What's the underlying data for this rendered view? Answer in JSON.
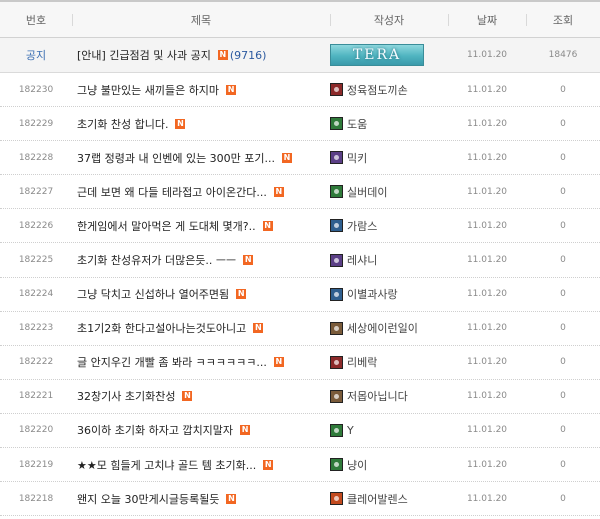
{
  "headers": {
    "no": "번호",
    "title": "제목",
    "author": "작성자",
    "date": "날짜",
    "views": "조회"
  },
  "new_badge": "N",
  "notice": {
    "no": "공지",
    "title": "[안내] 긴급점검 및 사과 공지",
    "comments": "(9716)",
    "author_banner": "TERA",
    "date": "11.01.20",
    "views": "18476"
  },
  "emblem_colors": {
    "red": "#8c2a2a",
    "green": "#2f7a3a",
    "purple": "#5b3f86",
    "blue": "#2f5f8f",
    "brown": "#7a5b3a",
    "orange": "#c24a1e"
  },
  "posts": [
    {
      "no": "182230",
      "title": "그냥 불만있는 새끼들은 하지마",
      "author": "정육점도끼손",
      "emblem": "red",
      "date": "11.01.20",
      "views": "0"
    },
    {
      "no": "182229",
      "title": "초기화 찬성 합니다.",
      "author": "도움",
      "emblem": "green",
      "date": "11.01.20",
      "views": "0"
    },
    {
      "no": "182228",
      "title": "37랩 정령과 내 인벤에 있는 300만 포기...",
      "author": "믹키",
      "emblem": "purple",
      "date": "11.01.20",
      "views": "0"
    },
    {
      "no": "182227",
      "title": "근데 보면 왜 다들 테라접고 아이온간다...",
      "author": "실버데이",
      "emblem": "green",
      "date": "11.01.20",
      "views": "0"
    },
    {
      "no": "182226",
      "title": "한게임에서 말아먹은 게 도대체 몇개?..",
      "author": "가람스",
      "emblem": "blue",
      "date": "11.01.20",
      "views": "0"
    },
    {
      "no": "182225",
      "title": "초기화 찬성유저가 더많은듯.. ㅡㅡ",
      "author": "레샤니",
      "emblem": "purple",
      "date": "11.01.20",
      "views": "0"
    },
    {
      "no": "182224",
      "title": "그냥 닥치고 신섭하나 열어주면됨",
      "author": "이별과사랑",
      "emblem": "blue",
      "date": "11.01.20",
      "views": "0"
    },
    {
      "no": "182223",
      "title": "초1기2화 한다고설아나는것도아니고",
      "author": "세상에이런일이",
      "emblem": "brown",
      "date": "11.01.20",
      "views": "0"
    },
    {
      "no": "182222",
      "title": "글 안지우긴 개빨 좀 봐라 ㅋㅋㅋㅋㅋㅋ...",
      "author": "리베락",
      "emblem": "red",
      "date": "11.01.20",
      "views": "0"
    },
    {
      "no": "182221",
      "title": "32창기사 초기화찬성",
      "author": "저몹아닙니다",
      "emblem": "brown",
      "date": "11.01.20",
      "views": "0"
    },
    {
      "no": "182220",
      "title": "36이하 초기화 하자고 깝치지말자",
      "author": "Y",
      "emblem": "green",
      "date": "11.01.20",
      "views": "0"
    },
    {
      "no": "182219",
      "title": "★★모 힘들게 고치냐 골드 템 초기화...",
      "author": "냥이",
      "emblem": "green",
      "date": "11.01.20",
      "views": "0"
    },
    {
      "no": "182218",
      "title": "왠지 오늘 30만게시글등록될듯",
      "author": "클레어발렌스",
      "emblem": "orange",
      "date": "11.01.20",
      "views": "0"
    }
  ]
}
